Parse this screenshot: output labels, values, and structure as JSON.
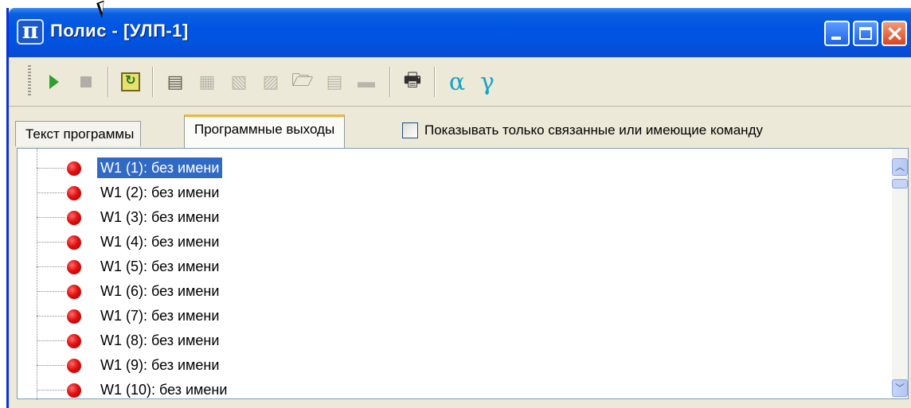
{
  "window": {
    "title": "Полис - [УЛП-1]",
    "icon": "pi-icon",
    "app_icon_glyph": "π"
  },
  "toolbar": {
    "buttons": [
      {
        "icon": "play-icon"
      },
      {
        "icon": "stop-icon"
      },
      {
        "icon": "refresh-icon",
        "glyph": "↻"
      },
      {
        "icon": "copy-docs-icon",
        "glyph": "▤"
      },
      {
        "icon": "paste-disabled-icon",
        "glyph": "▦"
      },
      {
        "icon": "copy-disabled-icon",
        "glyph": "▧"
      },
      {
        "icon": "cut-disabled-icon",
        "glyph": "▨"
      },
      {
        "icon": "open-folder-icon",
        "glyph": "🗁"
      },
      {
        "icon": "document-disabled-icon",
        "glyph": "▤"
      },
      {
        "icon": "folder-disabled-icon",
        "glyph": "▬"
      },
      {
        "icon": "print-icon",
        "glyph": "🖶"
      },
      {
        "icon": "alpha-icon",
        "glyph": "α"
      },
      {
        "icon": "gamma-icon",
        "glyph": "γ"
      }
    ]
  },
  "tabs": {
    "inactive_label": "Текст программы",
    "active_label": "Программные выходы"
  },
  "filter": {
    "label": "Показывать только связанные или имеющие команду",
    "checked": false
  },
  "tree": {
    "items": [
      "W1 (1): без имени",
      "W1 (2): без имени",
      "W1 (3): без имени",
      "W1 (4): без имени",
      "W1 (5): без имени",
      "W1 (6): без имени",
      "W1 (7): без имени",
      "W1 (8): без имени",
      "W1 (9): без имени",
      "W1 (10): без имени"
    ],
    "selected_index": 0
  },
  "scrollbar": {
    "up_glyph": "︿",
    "down_glyph": "﹀"
  },
  "colors": {
    "titlebar": "#0054e3",
    "selection": "#316ac5",
    "status_led": "#e01010",
    "greek_accent": "#19a3c7"
  }
}
